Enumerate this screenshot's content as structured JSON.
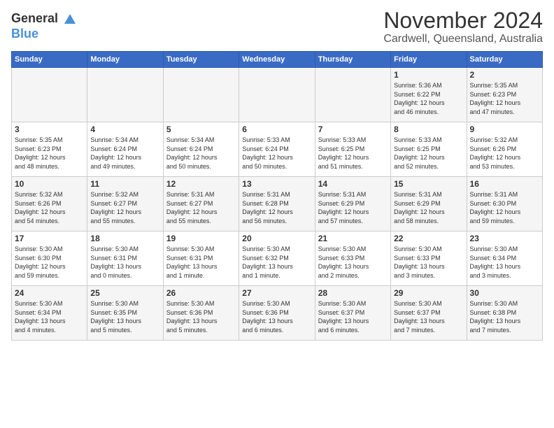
{
  "logo": {
    "general": "General",
    "blue": "Blue"
  },
  "title": "November 2024",
  "location": "Cardwell, Queensland, Australia",
  "days_of_week": [
    "Sunday",
    "Monday",
    "Tuesday",
    "Wednesday",
    "Thursday",
    "Friday",
    "Saturday"
  ],
  "weeks": [
    [
      {
        "day": "",
        "info": ""
      },
      {
        "day": "",
        "info": ""
      },
      {
        "day": "",
        "info": ""
      },
      {
        "day": "",
        "info": ""
      },
      {
        "day": "",
        "info": ""
      },
      {
        "day": "1",
        "info": "Sunrise: 5:36 AM\nSunset: 6:22 PM\nDaylight: 12 hours\nand 46 minutes."
      },
      {
        "day": "2",
        "info": "Sunrise: 5:35 AM\nSunset: 6:23 PM\nDaylight: 12 hours\nand 47 minutes."
      }
    ],
    [
      {
        "day": "3",
        "info": "Sunrise: 5:35 AM\nSunset: 6:23 PM\nDaylight: 12 hours\nand 48 minutes."
      },
      {
        "day": "4",
        "info": "Sunrise: 5:34 AM\nSunset: 6:24 PM\nDaylight: 12 hours\nand 49 minutes."
      },
      {
        "day": "5",
        "info": "Sunrise: 5:34 AM\nSunset: 6:24 PM\nDaylight: 12 hours\nand 50 minutes."
      },
      {
        "day": "6",
        "info": "Sunrise: 5:33 AM\nSunset: 6:24 PM\nDaylight: 12 hours\nand 50 minutes."
      },
      {
        "day": "7",
        "info": "Sunrise: 5:33 AM\nSunset: 6:25 PM\nDaylight: 12 hours\nand 51 minutes."
      },
      {
        "day": "8",
        "info": "Sunrise: 5:33 AM\nSunset: 6:25 PM\nDaylight: 12 hours\nand 52 minutes."
      },
      {
        "day": "9",
        "info": "Sunrise: 5:32 AM\nSunset: 6:26 PM\nDaylight: 12 hours\nand 53 minutes."
      }
    ],
    [
      {
        "day": "10",
        "info": "Sunrise: 5:32 AM\nSunset: 6:26 PM\nDaylight: 12 hours\nand 54 minutes."
      },
      {
        "day": "11",
        "info": "Sunrise: 5:32 AM\nSunset: 6:27 PM\nDaylight: 12 hours\nand 55 minutes."
      },
      {
        "day": "12",
        "info": "Sunrise: 5:31 AM\nSunset: 6:27 PM\nDaylight: 12 hours\nand 55 minutes."
      },
      {
        "day": "13",
        "info": "Sunrise: 5:31 AM\nSunset: 6:28 PM\nDaylight: 12 hours\nand 56 minutes."
      },
      {
        "day": "14",
        "info": "Sunrise: 5:31 AM\nSunset: 6:29 PM\nDaylight: 12 hours\nand 57 minutes."
      },
      {
        "day": "15",
        "info": "Sunrise: 5:31 AM\nSunset: 6:29 PM\nDaylight: 12 hours\nand 58 minutes."
      },
      {
        "day": "16",
        "info": "Sunrise: 5:31 AM\nSunset: 6:30 PM\nDaylight: 12 hours\nand 59 minutes."
      }
    ],
    [
      {
        "day": "17",
        "info": "Sunrise: 5:30 AM\nSunset: 6:30 PM\nDaylight: 12 hours\nand 59 minutes."
      },
      {
        "day": "18",
        "info": "Sunrise: 5:30 AM\nSunset: 6:31 PM\nDaylight: 13 hours\nand 0 minutes."
      },
      {
        "day": "19",
        "info": "Sunrise: 5:30 AM\nSunset: 6:31 PM\nDaylight: 13 hours\nand 1 minute."
      },
      {
        "day": "20",
        "info": "Sunrise: 5:30 AM\nSunset: 6:32 PM\nDaylight: 13 hours\nand 1 minute."
      },
      {
        "day": "21",
        "info": "Sunrise: 5:30 AM\nSunset: 6:33 PM\nDaylight: 13 hours\nand 2 minutes."
      },
      {
        "day": "22",
        "info": "Sunrise: 5:30 AM\nSunset: 6:33 PM\nDaylight: 13 hours\nand 3 minutes."
      },
      {
        "day": "23",
        "info": "Sunrise: 5:30 AM\nSunset: 6:34 PM\nDaylight: 13 hours\nand 3 minutes."
      }
    ],
    [
      {
        "day": "24",
        "info": "Sunrise: 5:30 AM\nSunset: 6:34 PM\nDaylight: 13 hours\nand 4 minutes."
      },
      {
        "day": "25",
        "info": "Sunrise: 5:30 AM\nSunset: 6:35 PM\nDaylight: 13 hours\nand 5 minutes."
      },
      {
        "day": "26",
        "info": "Sunrise: 5:30 AM\nSunset: 6:36 PM\nDaylight: 13 hours\nand 5 minutes."
      },
      {
        "day": "27",
        "info": "Sunrise: 5:30 AM\nSunset: 6:36 PM\nDaylight: 13 hours\nand 6 minutes."
      },
      {
        "day": "28",
        "info": "Sunrise: 5:30 AM\nSunset: 6:37 PM\nDaylight: 13 hours\nand 6 minutes."
      },
      {
        "day": "29",
        "info": "Sunrise: 5:30 AM\nSunset: 6:37 PM\nDaylight: 13 hours\nand 7 minutes."
      },
      {
        "day": "30",
        "info": "Sunrise: 5:30 AM\nSunset: 6:38 PM\nDaylight: 13 hours\nand 7 minutes."
      }
    ]
  ]
}
